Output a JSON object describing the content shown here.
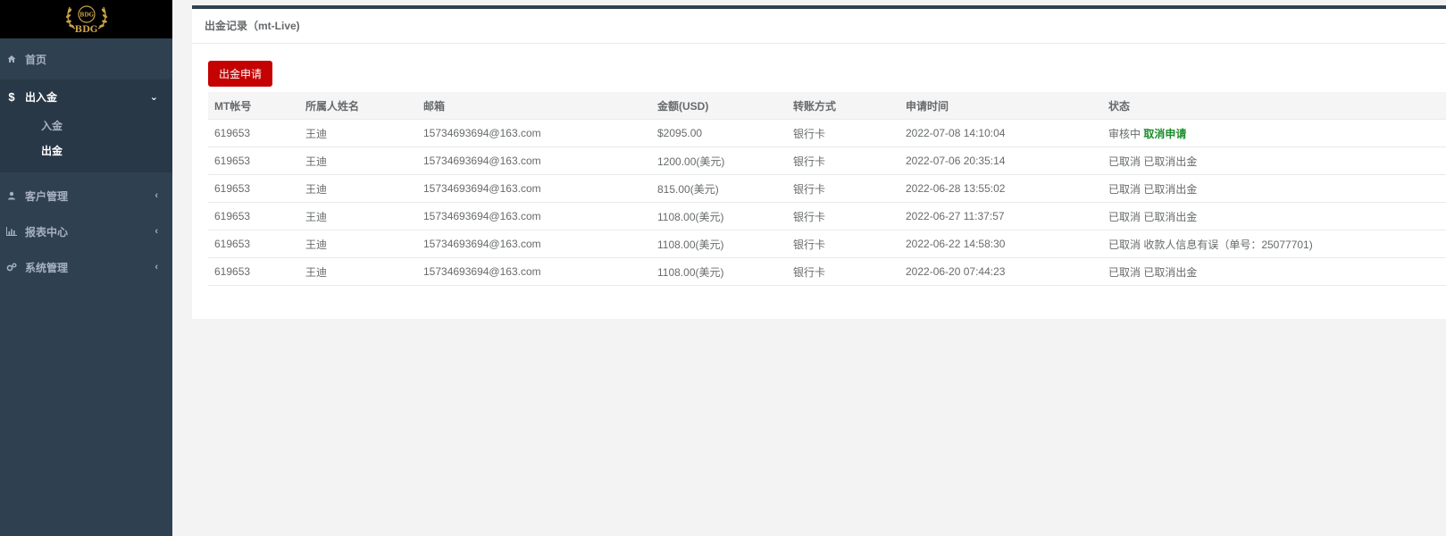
{
  "sidebar": {
    "logo_text": "BDG",
    "items": [
      {
        "label": "首页",
        "icon": "home-icon"
      },
      {
        "label": "出入金",
        "icon": "dollar-icon",
        "expanded": true,
        "children": [
          {
            "label": "入金"
          },
          {
            "label": "出金",
            "active": true
          }
        ]
      },
      {
        "label": "客户管理",
        "icon": "user-icon"
      },
      {
        "label": "报表中心",
        "icon": "bar-chart-icon"
      },
      {
        "label": "系统管理",
        "icon": "gears-icon"
      }
    ]
  },
  "panel": {
    "title": "出金记录（mt-Live)",
    "apply_button": "出金申请"
  },
  "table": {
    "headers": [
      "MT帐号",
      "所属人姓名",
      "邮箱",
      "金额(USD)",
      "转账方式",
      "申请时间",
      "状态"
    ],
    "rows": [
      {
        "mt": "619653",
        "name": "王迪",
        "email": "15734693694@163.com",
        "amount": "$2095.00",
        "method": "银行卡",
        "time": "2022-07-08 14:10:04",
        "status": "审核中",
        "action": "取消申请"
      },
      {
        "mt": "619653",
        "name": "王迪",
        "email": "15734693694@163.com",
        "amount": "1200.00(美元)",
        "method": "银行卡",
        "time": "2022-07-06 20:35:14",
        "status": "已取消 已取消出金"
      },
      {
        "mt": "619653",
        "name": "王迪",
        "email": "15734693694@163.com",
        "amount": "815.00(美元)",
        "method": "银行卡",
        "time": "2022-06-28 13:55:02",
        "status": "已取消 已取消出金"
      },
      {
        "mt": "619653",
        "name": "王迪",
        "email": "15734693694@163.com",
        "amount": "1108.00(美元)",
        "method": "银行卡",
        "time": "2022-06-27 11:37:57",
        "status": "已取消 已取消出金"
      },
      {
        "mt": "619653",
        "name": "王迪",
        "email": "15734693694@163.com",
        "amount": "1108.00(美元)",
        "method": "银行卡",
        "time": "2022-06-22 14:58:30",
        "status": "已取消 收款人信息有误（单号：25077701)"
      },
      {
        "mt": "619653",
        "name": "王迪",
        "email": "15734693694@163.com",
        "amount": "1108.00(美元)",
        "method": "银行卡",
        "time": "2022-06-20 07:44:23",
        "status": "已取消 已取消出金"
      }
    ]
  },
  "colors": {
    "sidebar_bg": "#2f4050",
    "accent_red": "#c50202",
    "action_green": "#1c8d2a"
  }
}
